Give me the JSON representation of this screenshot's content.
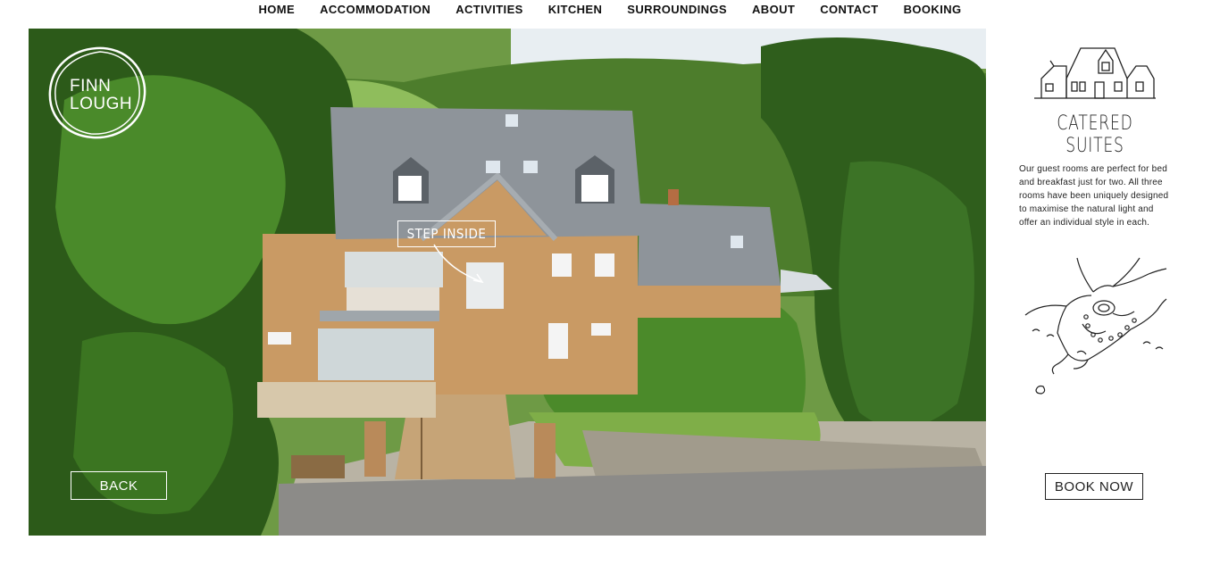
{
  "nav": {
    "items": [
      "HOME",
      "ACCOMMODATION",
      "ACTIVITIES",
      "KITCHEN",
      "SURROUNDINGS",
      "ABOUT",
      "CONTACT",
      "BOOKING"
    ]
  },
  "hero": {
    "logo_line1": "FINN",
    "logo_line2": "LOUGH",
    "step_inside_label": "STEP INSIDE",
    "back_label": "BACK"
  },
  "sidebar": {
    "title": "CATERED SUITES",
    "description": "Our guest rooms are perfect for bed and breakfast just for two. All three rooms have been uniquely designed to maximise the natural light and offer an individual style in each.",
    "book_now_label": "BOOK NOW"
  },
  "colors": {
    "text": "#111111",
    "button_outline_light": "#ffffff",
    "button_outline_dark": "#222222"
  }
}
